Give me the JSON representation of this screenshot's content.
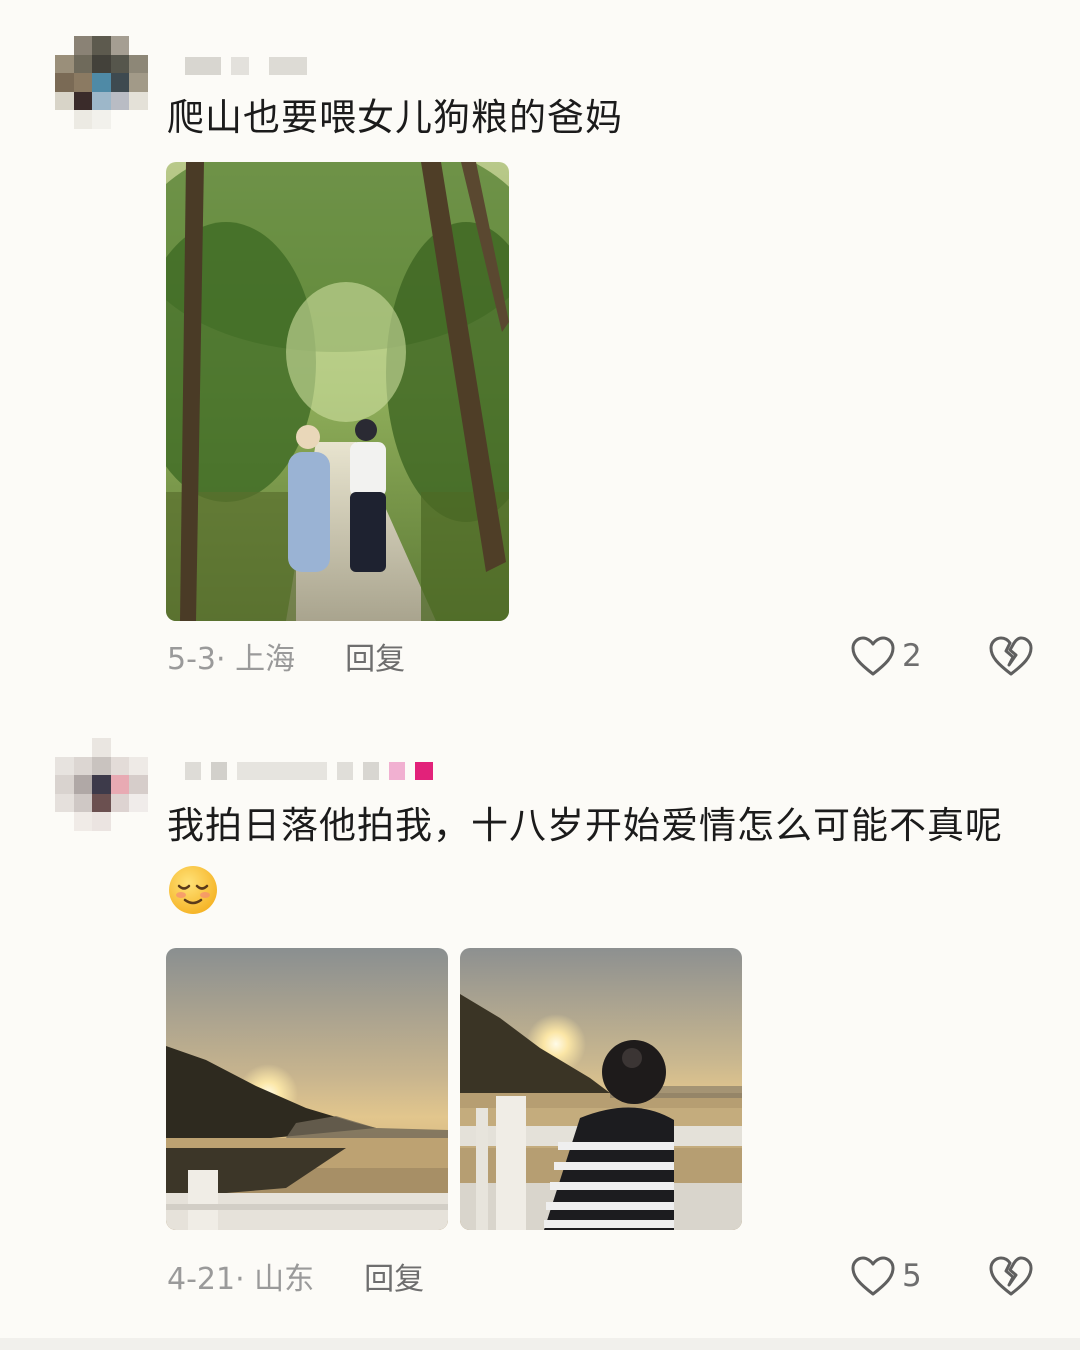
{
  "comments": [
    {
      "text": "爬山也要喂女儿狗粮的爸妈",
      "date_location": "5-3· 上海",
      "reply_label": "回复",
      "like_count": "2",
      "photos": [
        "couple-on-forest-path"
      ]
    },
    {
      "text": "我拍日落他拍我，十八岁开始爱情怎么可能不真呢",
      "emoji": "smiling-face-with-closed-eyes",
      "date_location": "4-21· 山东",
      "reply_label": "回复",
      "like_count": "5",
      "photos": [
        "sunset-over-lake",
        "woman-photographing-sunset"
      ]
    }
  ],
  "icons": {
    "like": "heart-outline-icon",
    "dislike": "broken-heart-icon"
  },
  "colors": {
    "background": "#fcfbf7",
    "text": "#1b1b1b",
    "meta": "#9a9a9a",
    "reply": "#6e6e6e"
  }
}
